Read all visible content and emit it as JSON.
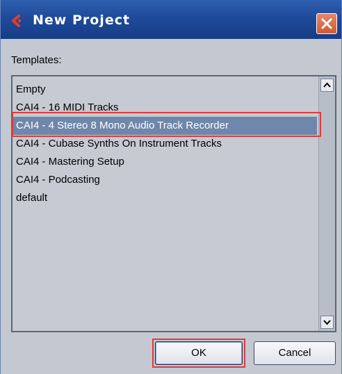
{
  "window": {
    "title": "New Project",
    "close_icon": "close-icon",
    "logo_icon": "cubase-logo-icon"
  },
  "templates": {
    "label": "Templates:",
    "items": [
      {
        "label": "Empty",
        "selected": false
      },
      {
        "label": "CAI4 - 16 MIDI Tracks",
        "selected": false
      },
      {
        "label": "CAI4 - 4 Stereo 8 Mono Audio Track Recorder",
        "selected": true
      },
      {
        "label": "CAI4 - Cubase Synths On Instrument Tracks",
        "selected": false
      },
      {
        "label": "CAI4 - Mastering Setup",
        "selected": false
      },
      {
        "label": "CAI4 - Podcasting",
        "selected": false
      },
      {
        "label": "default",
        "selected": false
      }
    ]
  },
  "buttons": {
    "ok_label": "OK",
    "cancel_label": "Cancel"
  },
  "colors": {
    "titlebar": "#1f4a9a",
    "selection": "#6e87aa",
    "highlight": "#e03a3a",
    "close_button": "#d05a33"
  }
}
